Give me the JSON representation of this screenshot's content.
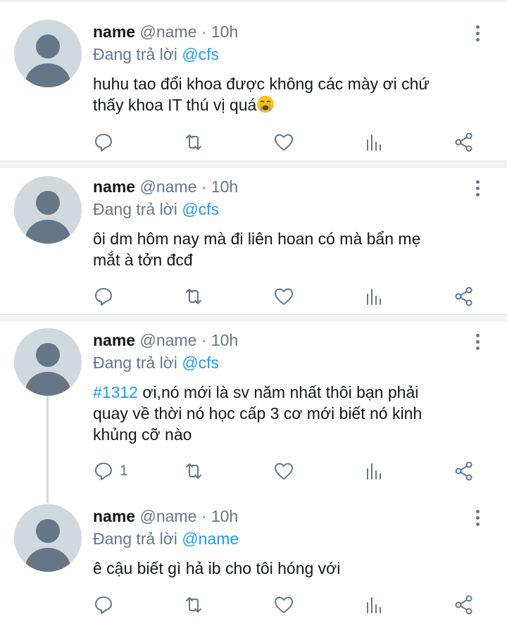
{
  "tweets": [
    {
      "name": "name",
      "handle": "@name",
      "dot": "·",
      "time": "10h",
      "reply_prefix": "Đang trả lời",
      "reply_to": "@cfs",
      "text_line1": "huhu tao đổi khoa được không các mày ơi chứ",
      "text_line2": "thấy khoa IT thú vị quá",
      "emoji": "loudly-crying-face",
      "reply_count": ""
    },
    {
      "name": "name",
      "handle": "@name",
      "dot": "·",
      "time": "10h",
      "reply_prefix": "Đang trả lời",
      "reply_to": "@cfs",
      "text_line1": "ôi dm hôm nay mà đi liên hoan có mà bẩn mẹ",
      "text_line2": "mắt à tởn đcđ",
      "reply_count": ""
    },
    {
      "name": "name",
      "handle": "@name",
      "dot": "·",
      "time": "10h",
      "reply_prefix": "Đang trả lời",
      "reply_to": "@cfs",
      "hashtag": "#1312",
      "text_line1": " ơi,nó mới là sv năm nhất thôi bạn phải",
      "text_line2": "quay về thời nó học cấp 3 cơ mới biết nó kinh",
      "text_line3": "khủng cỡ nào",
      "reply_count": "1"
    },
    {
      "name": "name",
      "handle": "@name",
      "dot": "·",
      "time": "10h",
      "reply_prefix": "Đang trả lời",
      "reply_to": "@name",
      "text_line1": "ê cậu biết gì hả ib cho tôi hóng với",
      "reply_count": ""
    }
  ],
  "colors": {
    "accent": "#1d9bf0",
    "muted": "#657786",
    "avatar_bg": "#cfd9de",
    "avatar_fg": "#657786"
  },
  "icons": [
    "more-vertical-icon",
    "reply-icon",
    "retweet-icon",
    "like-icon",
    "analytics-icon",
    "share-icon"
  ]
}
